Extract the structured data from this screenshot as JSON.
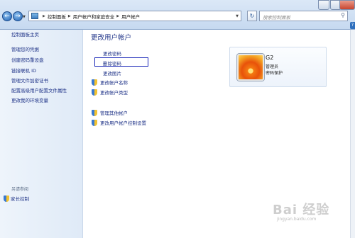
{
  "address_bar": {
    "crumbs": [
      "控制面板",
      "用户帐户和家庭安全",
      "用户帐户"
    ],
    "search_placeholder": "搜索控制面板"
  },
  "left_pane": {
    "home": "控制面板主页",
    "links": [
      "管理您的凭据",
      "创建密码重设盘",
      "链接联机 ID",
      "管理文件加密证书",
      "配置高级用户配置文件属性",
      "更改我的环境变量"
    ],
    "see_also": "另请参阅",
    "parental_controls": "家长控制"
  },
  "main": {
    "title": "更改用户帐户",
    "tasks": [
      "更改密码",
      "删除密码",
      "更改图片",
      "更改帐户名称",
      "更改帐户类型"
    ],
    "other_tasks": [
      "管理其他帐户",
      "更改用户帐户控制设置"
    ]
  },
  "account": {
    "name": "G2",
    "role": "管理员",
    "status": "密码保护"
  },
  "watermark": {
    "logo": "Bai 经验",
    "url": "jingyan.baidu.com"
  },
  "icons": {
    "shield": "uac-shield-icon"
  }
}
